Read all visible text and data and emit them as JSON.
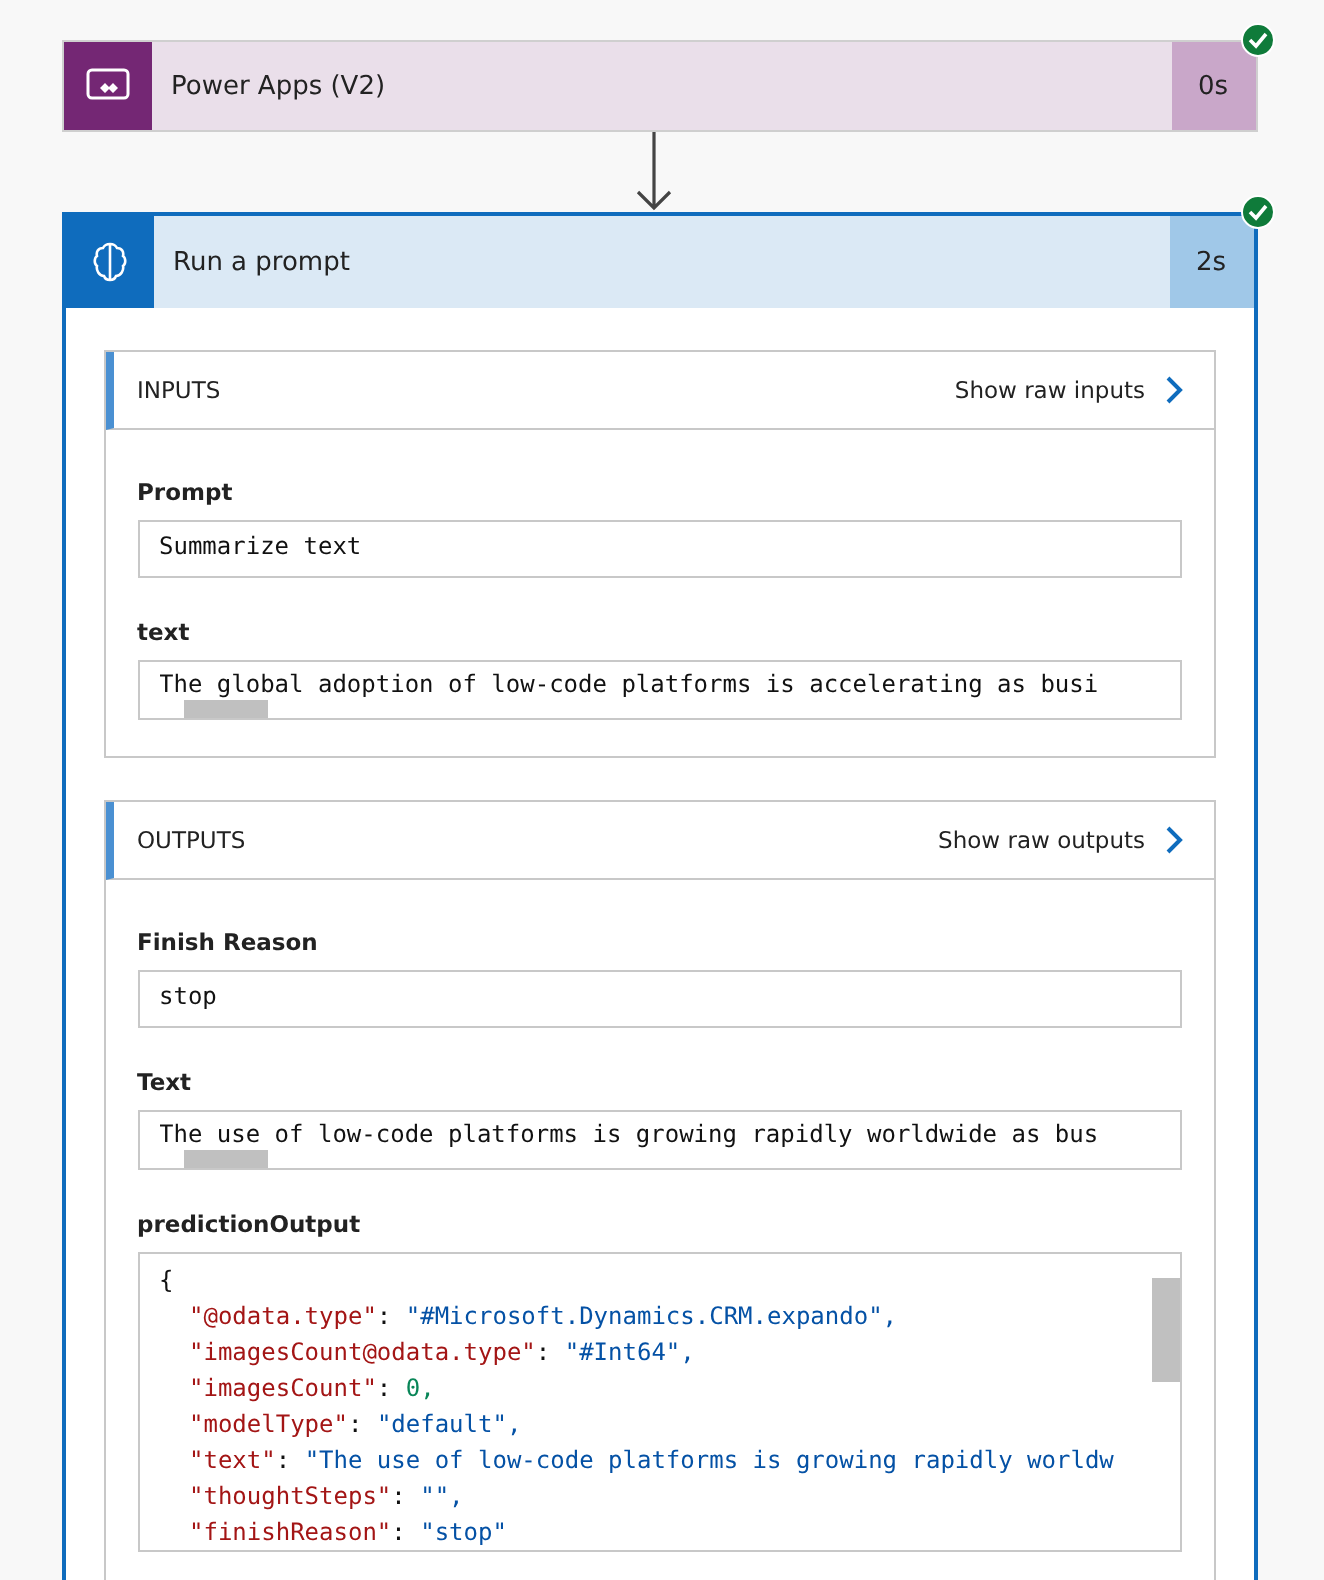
{
  "flow": [
    {
      "kind": "trigger",
      "title": "Power Apps (V2)",
      "duration": "0s",
      "succeeded": true
    },
    {
      "kind": "prompt",
      "title": "Run a prompt",
      "duration": "2s",
      "succeeded": true
    }
  ],
  "sections": [
    {
      "title": "INPUTS",
      "link": "Show raw inputs",
      "fields": [
        {
          "kind": "plain",
          "label": "Prompt",
          "value": "Summarize text"
        },
        {
          "kind": "scroll",
          "label": "text",
          "value": "The global adoption of low-code platforms is accelerating as busi"
        }
      ]
    },
    {
      "title": "OUTPUTS",
      "link": "Show raw outputs",
      "fields": [
        {
          "kind": "plain",
          "label": "Finish Reason",
          "value": "stop"
        },
        {
          "kind": "scroll",
          "label": "Text",
          "value": "The use of low-code platforms is growing rapidly worldwide as bus"
        },
        {
          "kind": "code",
          "label": "predictionOutput",
          "open": "{",
          "lines": [
            {
              "key": "\"@odata.type\"",
              "sep": ":",
              "value": "\"#Microsoft.Dynamics.CRM.expando\",",
              "kind": "string"
            },
            {
              "key": "\"imagesCount@odata.type\"",
              "sep": ":",
              "value": "\"#Int64\",",
              "kind": "string"
            },
            {
              "key": "\"imagesCount\"",
              "sep": ":",
              "value": "0,",
              "kind": "number"
            },
            {
              "key": "\"modelType\"",
              "sep": ":",
              "value": "\"default\",",
              "kind": "string"
            },
            {
              "key": "\"text\"",
              "sep": ":",
              "value": "\"The use of low-code platforms is growing rapidly worldw",
              "kind": "string"
            },
            {
              "key": "\"thoughtSteps\"",
              "sep": ":",
              "value": "\"\",",
              "kind": "string"
            },
            {
              "key": "\"finishReason\"",
              "sep": ":",
              "value": "\"stop\"",
              "kind": "string"
            }
          ]
        }
      ]
    }
  ]
}
